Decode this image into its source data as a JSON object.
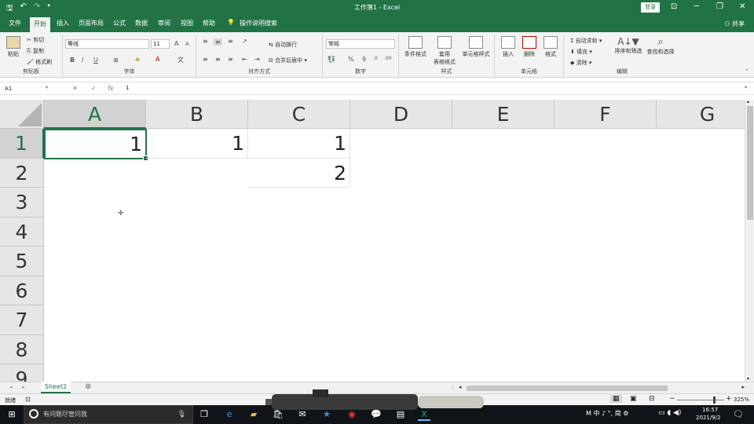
{
  "title_bar": {
    "title": "工作簿1 - Excel",
    "login_label": "登录",
    "ribbon_display_icon": "ribbon-display-icon",
    "minimize_glyph": "─",
    "restore_glyph": "❐",
    "close_glyph": "✕"
  },
  "ribbon_tabs": [
    "文件",
    "开始",
    "插入",
    "页面布局",
    "公式",
    "数据",
    "审阅",
    "视图",
    "帮助"
  ],
  "tell_me": "操作说明搜索",
  "share": "共享",
  "ribbon": {
    "clipboard": {
      "paste": "粘贴",
      "cut": "剪切",
      "copy": "复制",
      "format_painter": "格式刷",
      "label": "剪贴板"
    },
    "font": {
      "name": "等线",
      "size": "11",
      "bold": "B",
      "italic": "I",
      "underline": "U",
      "label": "字体",
      "grow": "A",
      "shrink": "A"
    },
    "alignment": {
      "wrap": "自动换行",
      "merge": "合并后居中",
      "label": "对齐方式"
    },
    "number": {
      "format": "常规",
      "percent": "%",
      "comma": "9",
      "label": "数字"
    },
    "styles": {
      "conditional": "条件格式",
      "table_line1": "套用",
      "table_line2": "表格格式",
      "cell_styles": "单元格样式",
      "label": "样式"
    },
    "cells": {
      "insert": "插入",
      "delete": "删除",
      "format": "格式",
      "label": "单元格"
    },
    "editing": {
      "autosum": "自动求和",
      "fill": "填充",
      "clear": "清除",
      "sort": "排序和筛选",
      "find": "查找和选择",
      "label": "编辑"
    }
  },
  "formula_bar": {
    "name_box": "A1",
    "fx": "fx",
    "value": "1"
  },
  "columns": [
    "A",
    "B",
    "C",
    "D",
    "E",
    "F",
    "G"
  ],
  "rows": [
    "1",
    "2",
    "3",
    "4",
    "5",
    "6",
    "7",
    "8",
    "9"
  ],
  "cells": {
    "A1": "1",
    "B1": "1",
    "C1": "1",
    "C2": "2"
  },
  "sheet_tab": "Sheet2",
  "status": {
    "ready": "就绪",
    "zoom": "325%"
  },
  "taskbar": {
    "search_placeholder": "有问题尽管问我",
    "ime": "M 中 ♪ °, 简 ⚙",
    "time": "16:57",
    "date": "2021/9/2"
  },
  "accent": "#217346"
}
